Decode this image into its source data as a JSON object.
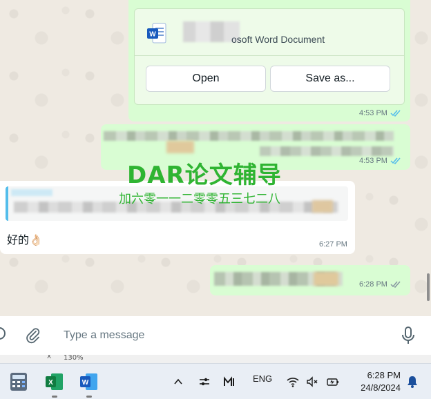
{
  "chat": {
    "document_message": {
      "doc_type": "osoft Word Document",
      "open_label": "Open",
      "save_label": "Save as...",
      "time": "4:53 PM"
    },
    "message_2": {
      "time": "4:53 PM"
    },
    "watermark": {
      "title": "DAR论文辅导",
      "subtitle": "加六零一一二零零五三七二八"
    },
    "message_3": {
      "text": "好的👌🏻",
      "time": "6:27 PM"
    },
    "message_4": {
      "time": "6:28 PM"
    }
  },
  "composer": {
    "placeholder": "Type a message"
  },
  "status_strip": {
    "close_glyph": "X",
    "zoom": "130%"
  },
  "taskbar": {
    "language": "ENG",
    "time": "6:28 PM",
    "date": "24/8/2024"
  },
  "colors": {
    "outgoing_bubble": "#d9fdd3",
    "incoming_bubble": "#ffffff",
    "read_tick": "#53bdeb",
    "watermark": "#2fb432"
  }
}
